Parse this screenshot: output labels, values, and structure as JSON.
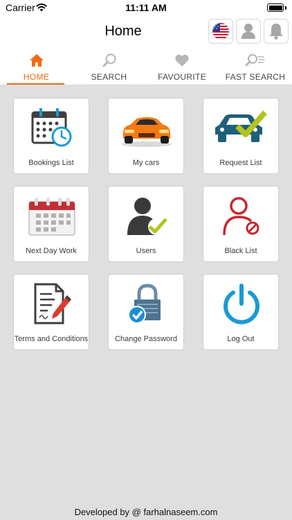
{
  "status_bar": {
    "carrier": "Carrier",
    "time": "11:11 AM"
  },
  "nav": {
    "title": "Home",
    "flag_icon": "us-flag-icon",
    "user_icon": "user-icon",
    "bell_icon": "bell-icon"
  },
  "tabs": [
    {
      "label": "HOME",
      "icon": "home-icon",
      "active": true
    },
    {
      "label": "SEARCH",
      "icon": "search-icon",
      "active": false
    },
    {
      "label": "FAVOURITE",
      "icon": "heart-icon",
      "active": false
    },
    {
      "label": "FAST SEARCH",
      "icon": "fast-search-icon",
      "active": false
    }
  ],
  "tiles": [
    {
      "label": "Bookings List",
      "icon": "calendar-clock-icon"
    },
    {
      "label": "My cars",
      "icon": "sports-car-icon"
    },
    {
      "label": "Request List",
      "icon": "car-check-icon"
    },
    {
      "label": "Next Day Work",
      "icon": "calendar-icon"
    },
    {
      "label": "Users",
      "icon": "user-check-icon"
    },
    {
      "label": "Black List",
      "icon": "user-blocked-icon"
    },
    {
      "label": "Terms and Conditions",
      "icon": "document-pen-icon"
    },
    {
      "label": "Change Password",
      "icon": "lock-check-icon"
    },
    {
      "label": "Log Out",
      "icon": "power-icon"
    }
  ],
  "footer": {
    "text": "Developed by @ farhalnaseem.com"
  },
  "colors": {
    "accent": "#ef6a12",
    "background": "#e0dfe0",
    "tile_background": "#ffffff"
  }
}
